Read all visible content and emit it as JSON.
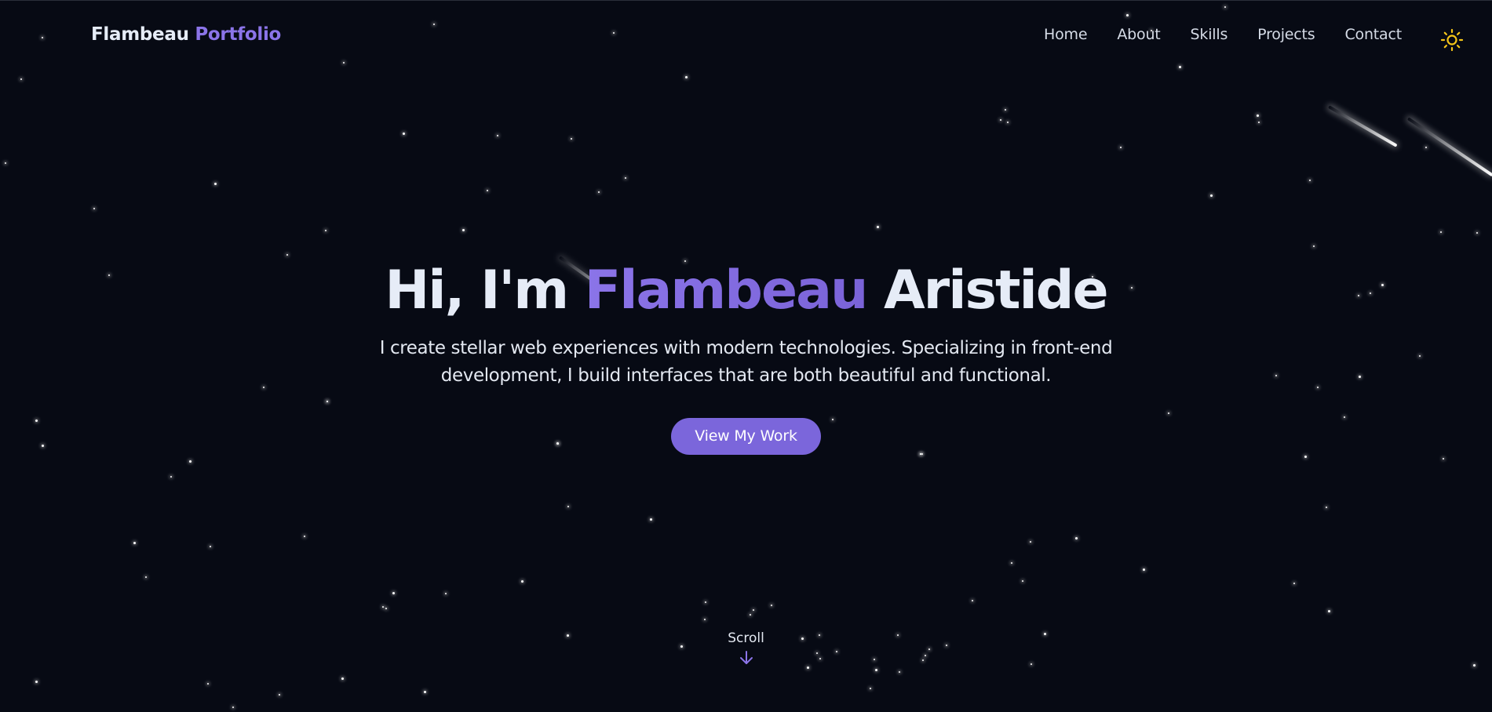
{
  "brand": {
    "first": "Flambeau",
    "second": "Portfolio"
  },
  "nav": {
    "items": [
      {
        "label": "Home"
      },
      {
        "label": "About"
      },
      {
        "label": "Skills"
      },
      {
        "label": "Projects"
      },
      {
        "label": "Contact"
      }
    ],
    "theme_toggle_icon": "sun-icon"
  },
  "hero": {
    "greeting": "Hi, I'm",
    "first_name": "Flambeau",
    "last_name": "Aristide",
    "subtitle": "I create stellar web experiences with modern technologies. Specializing in front-end development, I build interfaces that are both beautiful and functional.",
    "cta_label": "View My Work"
  },
  "scroll": {
    "label": "Scroll",
    "icon": "arrow-down-icon"
  },
  "colors": {
    "background": "#070a14",
    "accent": "#8b74e8",
    "button": "#7b66db",
    "text": "#e6ecf7",
    "sun": "#f5c518"
  }
}
